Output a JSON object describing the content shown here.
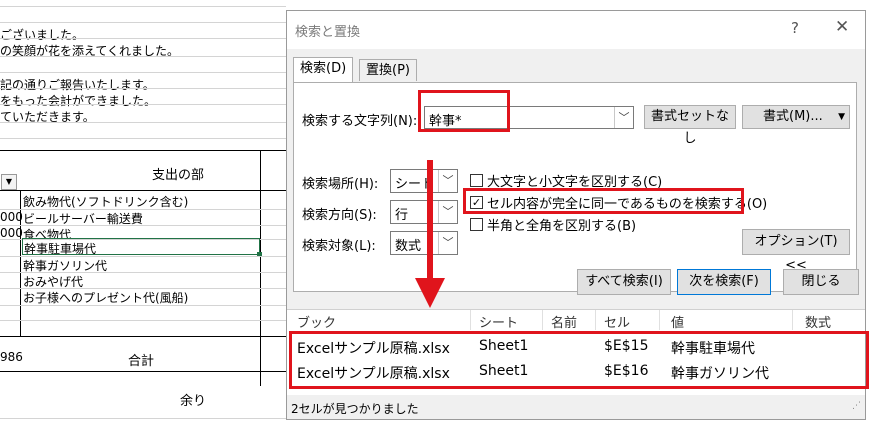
{
  "sheet": {
    "lines": [
      "ございました。",
      "の笑顔が花を添えてくれました。",
      "記の通りご報告いたします。",
      "をもった会計ができました。",
      "ていただきます。"
    ],
    "header": "支出の部",
    "rows": [
      {
        "num": "",
        "text": "飲み物代(ソフトドリンク含む)"
      },
      {
        "num": "000",
        "text": "ビールサーバー輸送費"
      },
      {
        "num": "000",
        "text": "食べ物代"
      },
      {
        "num": "",
        "text": "幹事駐車場代"
      },
      {
        "num": "",
        "text": "幹事ガソリン代"
      },
      {
        "num": "",
        "text": "おみやげ代"
      },
      {
        "num": "",
        "text": "お子様へのプレゼント代(風船)"
      }
    ],
    "total_num": "986",
    "total_label": "合計",
    "amari": "余り"
  },
  "dialog": {
    "title": "検索と置換",
    "help": "?",
    "close": "✕",
    "tabs": [
      {
        "label": "検索(D)"
      },
      {
        "label": "置換(P)"
      }
    ],
    "find_label": "検索する文字列(N):",
    "find_value": "幹事*",
    "format_status": "書式セットなし",
    "format_button": "書式(M)...",
    "within_label": "検索場所(H):",
    "within_value": "シート",
    "direction_label": "検索方向(S):",
    "direction_value": "行",
    "lookin_label": "検索対象(L):",
    "lookin_value": "数式",
    "match_case": "大文字と小文字を区別する(C)",
    "match_entire": "セル内容が完全に同一であるものを検索する(O)",
    "match_width": "半角と全角を区別する(B)",
    "options_button": "オプション(T) <<",
    "find_all": "すべて検索(I)",
    "find_next": "次を検索(F)",
    "close_button": "閉じる"
  },
  "results": {
    "headers": [
      "ブック",
      "シート",
      "名前",
      "セル",
      "値",
      "数式"
    ],
    "rows": [
      {
        "book": "Excelサンプル原稿.xlsx",
        "sheet": "Sheet1",
        "name": "",
        "cell": "$E$15",
        "value": "幹事駐車場代",
        "formula": ""
      },
      {
        "book": "Excelサンプル原稿.xlsx",
        "sheet": "Sheet1",
        "name": "",
        "cell": "$E$16",
        "value": "幹事ガソリン代",
        "formula": ""
      }
    ],
    "status": "2セルが見つかりました"
  },
  "colors": {
    "highlight": "#e0141c",
    "selection": "#217346",
    "focus": "#0078d7"
  }
}
